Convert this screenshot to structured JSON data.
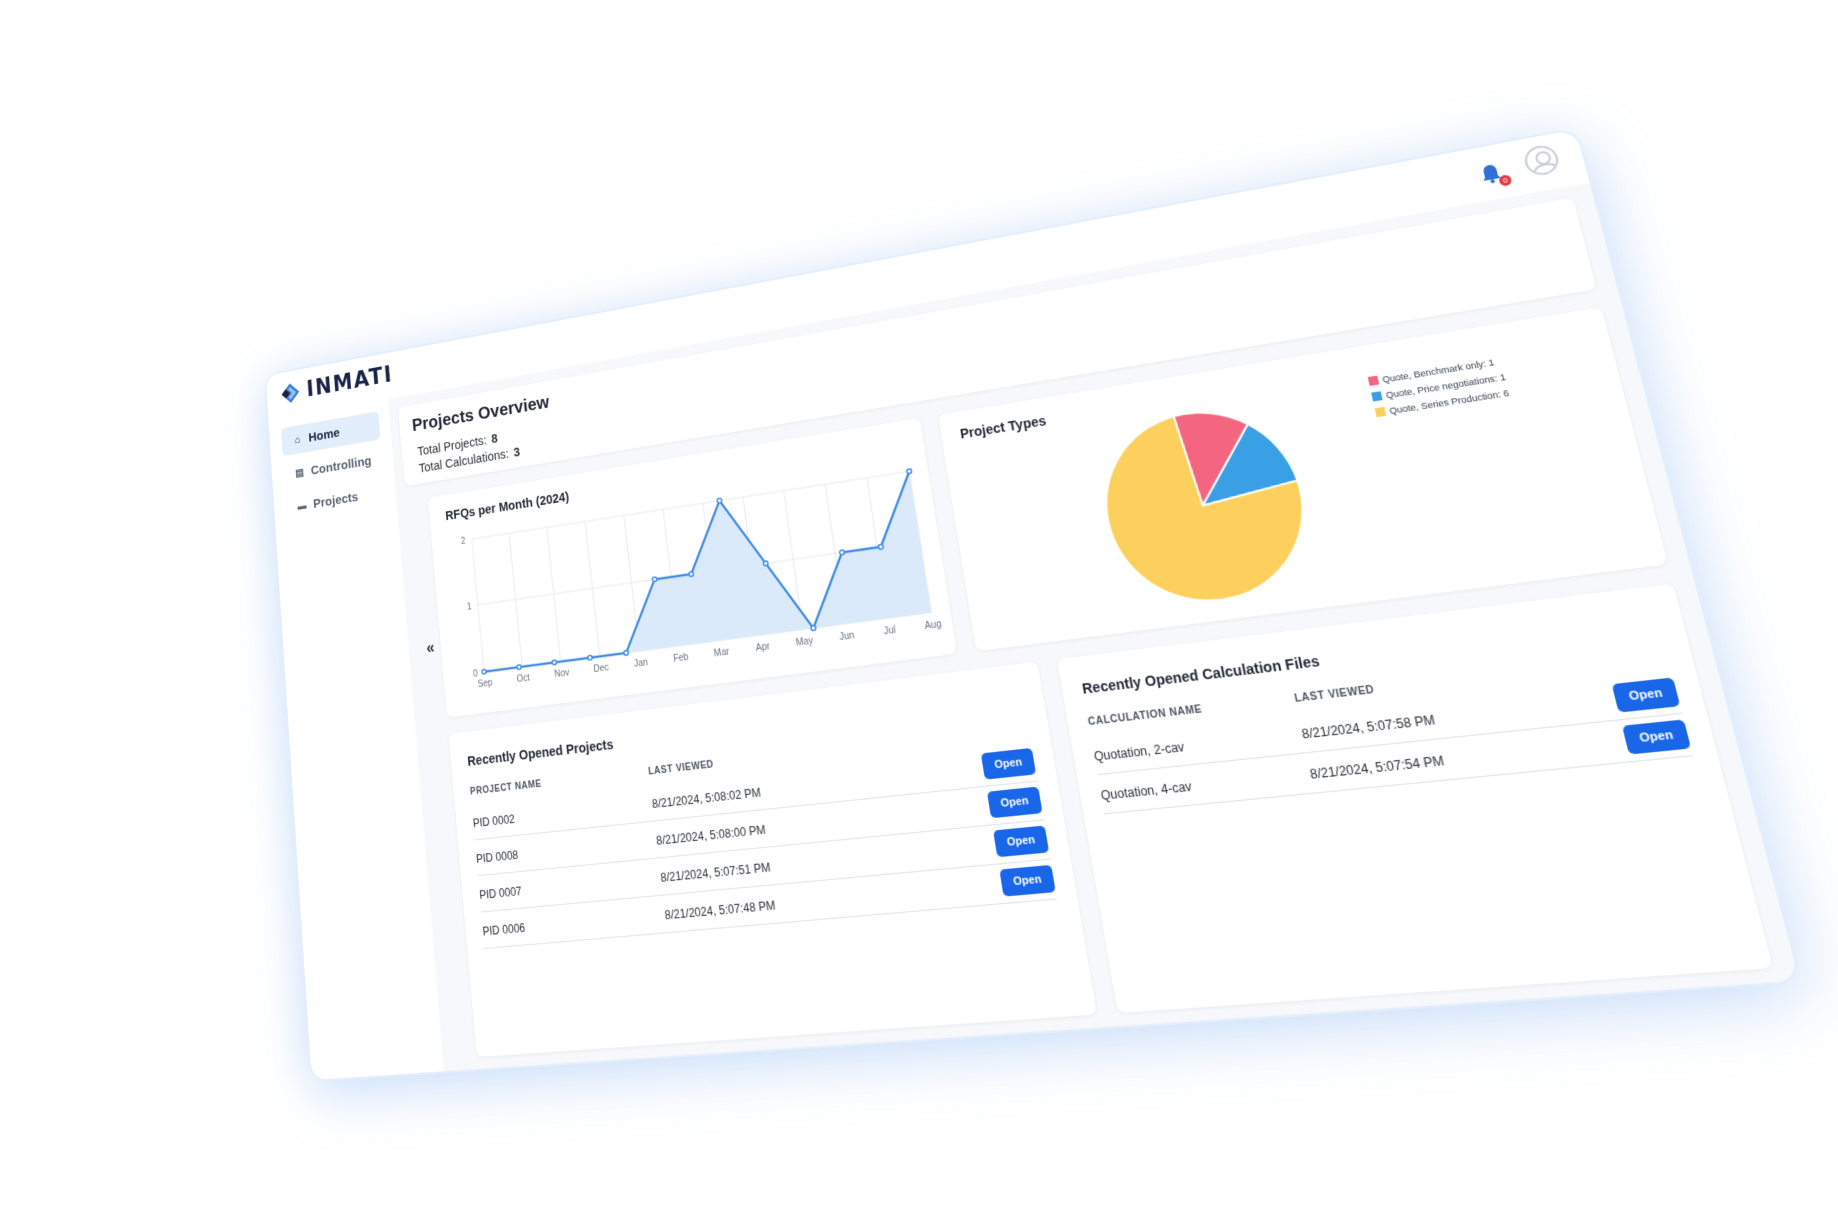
{
  "app": {
    "brand": "INMATI",
    "notifications": "0"
  },
  "sidebar": {
    "items": [
      {
        "label": "Home",
        "icon": "home-icon",
        "active": true
      },
      {
        "label": "Controlling",
        "icon": "table-icon",
        "active": false
      },
      {
        "label": "Projects",
        "icon": "folder-icon",
        "active": false
      }
    ],
    "collapse": "«"
  },
  "overview": {
    "title": "Projects Overview",
    "total_projects_label": "Total Projects:",
    "total_projects": "8",
    "total_calcs_label": "Total Calculations:",
    "total_calcs": "3"
  },
  "chart_data": [
    {
      "type": "area",
      "title": "RFQs per Month (2024)",
      "categories": [
        "Sep",
        "Oct",
        "Nov",
        "Dec",
        "Jan",
        "Feb",
        "Mar",
        "Apr",
        "May",
        "Jun",
        "Jul",
        "Aug"
      ],
      "x": [
        "Sep",
        "Oct",
        "Nov",
        "Dec",
        "Jan",
        "Feb",
        "Mar",
        "Apr",
        "May",
        "Jun",
        "Jul"
      ],
      "values": [
        0,
        0,
        0,
        0,
        0,
        1,
        1,
        2,
        1,
        0,
        1,
        1,
        2
      ],
      "series": [
        {
          "values": [
            0,
            0,
            0,
            0,
            0,
            1,
            1,
            2,
            1,
            0,
            1,
            1,
            2
          ]
        }
      ],
      "ylim": [
        0,
        2
      ],
      "yticks": [
        "0",
        "1",
        "2"
      ],
      "grid": true,
      "color": "#3d8ae6",
      "fill": "#dbeafb"
    },
    {
      "type": "pie",
      "title": "Project Types",
      "slices": [
        {
          "label": "Quote, Benchmark only: 1",
          "value": 1,
          "color": "#f4657f"
        },
        {
          "label": "Quote, Price negotiations: 1",
          "value": 1,
          "color": "#3aa0e6"
        },
        {
          "label": "Quote, Series Production: 6",
          "value": 6,
          "color": "#fdd05e"
        }
      ],
      "legend": "top-right"
    }
  ],
  "projects": {
    "title": "Recently Opened Projects",
    "col_name": "PROJECT NAME",
    "col_viewed": "LAST VIEWED",
    "rows": [
      {
        "name": "PID 0002",
        "viewed": "8/21/2024, 5:08:02 PM",
        "action": "Open"
      },
      {
        "name": "PID 0008",
        "viewed": "8/21/2024, 5:08:00 PM",
        "action": "Open"
      },
      {
        "name": "PID 0007",
        "viewed": "8/21/2024, 5:07:51 PM",
        "action": "Open"
      },
      {
        "name": "PID 0006",
        "viewed": "8/21/2024, 5:07:48 PM",
        "action": "Open"
      }
    ]
  },
  "calcs": {
    "title": "Recently Opened Calculation Files",
    "col_name": "CALCULATION NAME",
    "col_viewed": "LAST VIEWED",
    "rows": [
      {
        "name": "Quotation, 2-cav",
        "viewed": "8/21/2024, 5:07:58 PM",
        "action": "Open"
      },
      {
        "name": "Quotation, 4-cav",
        "viewed": "8/21/2024, 5:07:54 PM",
        "action": "Open"
      }
    ]
  }
}
